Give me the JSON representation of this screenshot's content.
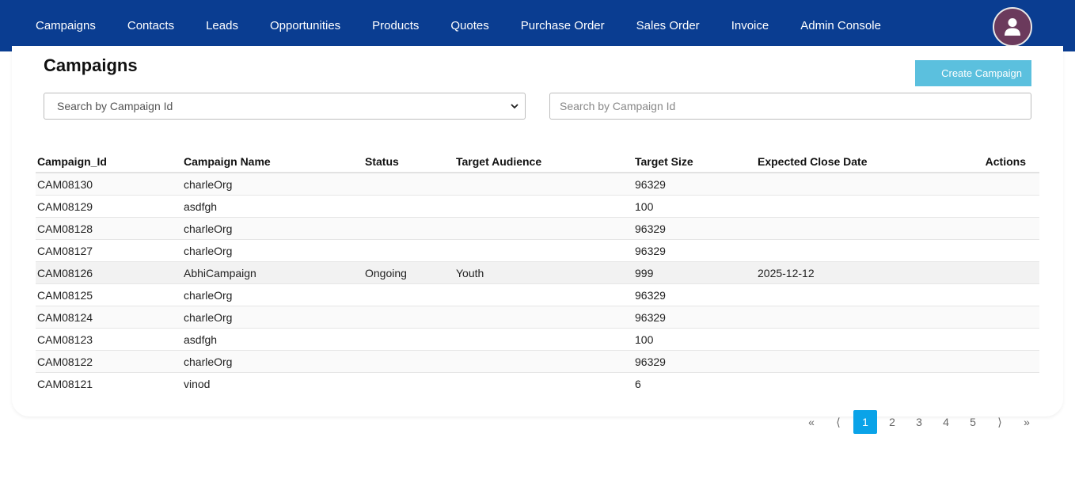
{
  "nav": {
    "items": [
      "Campaigns",
      "Contacts",
      "Leads",
      "Opportunities",
      "Products",
      "Quotes",
      "Purchase Order",
      "Sales Order",
      "Invoice",
      "Admin Console"
    ]
  },
  "header": {
    "title": "Campaigns",
    "create_label": "Create Campaign"
  },
  "filters": {
    "select_value": "Search by Campaign Id",
    "input_placeholder": "Search by Campaign Id"
  },
  "table": {
    "columns": [
      "Campaign_Id",
      "Campaign Name",
      "Status",
      "Target Audience",
      "Target Size",
      "Expected Close Date",
      "Actions"
    ],
    "rows": [
      [
        "CAM08130",
        "charleOrg",
        "",
        "",
        "96329",
        "",
        ""
      ],
      [
        "CAM08129",
        "asdfgh",
        "",
        "",
        "100",
        "",
        ""
      ],
      [
        "CAM08128",
        "charleOrg",
        "",
        "",
        "96329",
        "",
        ""
      ],
      [
        "CAM08127",
        "charleOrg",
        "",
        "",
        "96329",
        "",
        ""
      ],
      [
        "CAM08126",
        "AbhiCampaign",
        "Ongoing",
        "Youth",
        "999",
        "2025-12-12",
        ""
      ],
      [
        "CAM08125",
        "charleOrg",
        "",
        "",
        "96329",
        "",
        ""
      ],
      [
        "CAM08124",
        "charleOrg",
        "",
        "",
        "96329",
        "",
        ""
      ],
      [
        "CAM08123",
        "asdfgh",
        "",
        "",
        "100",
        "",
        ""
      ],
      [
        "CAM08122",
        "charleOrg",
        "",
        "",
        "96329",
        "",
        ""
      ],
      [
        "CAM08121",
        "vinod",
        "",
        "",
        "6",
        "",
        ""
      ]
    ]
  },
  "pagination": {
    "first": "«",
    "prev": "⟨",
    "pages": [
      "1",
      "2",
      "3",
      "4",
      "5"
    ],
    "next": "⟩",
    "last": "»",
    "current": "1"
  },
  "colors": {
    "navbar": "#0a3d91",
    "create_button": "#5bc0de",
    "active_page": "#0aa3e8",
    "avatar": "#6b3a5c"
  },
  "icons": {
    "avatar": "user-icon",
    "select": "chevron-down-icon"
  }
}
